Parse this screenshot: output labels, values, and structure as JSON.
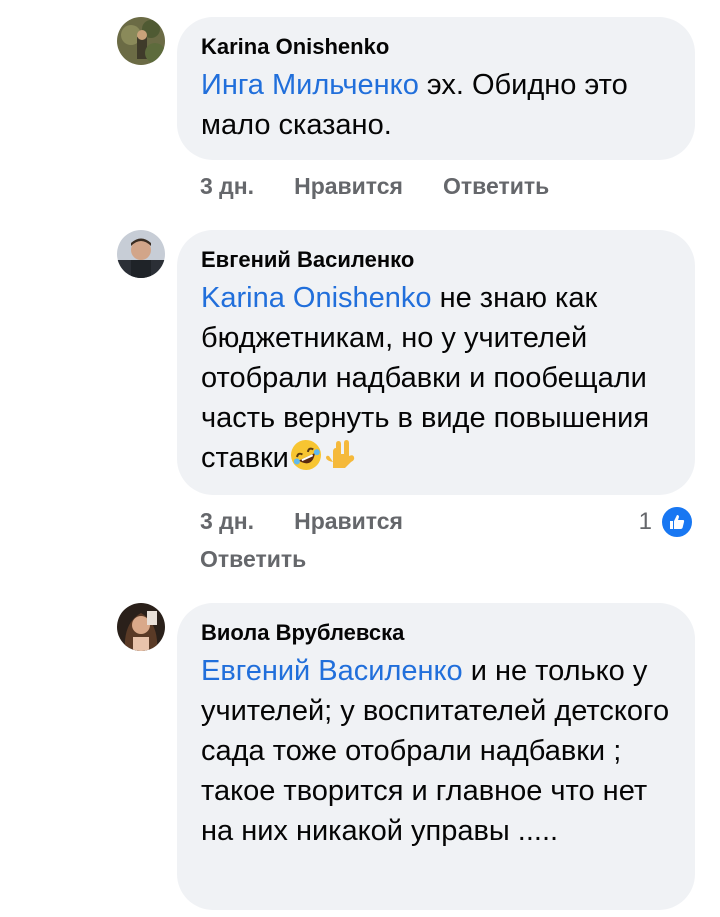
{
  "comments": [
    {
      "author": "Karina Onishenko",
      "mention": "Инга Мильченко",
      "text": " эх. Обидно это мало сказано.",
      "time": "3 дн.",
      "like_label": "Нравится",
      "reply_label": "Ответить"
    },
    {
      "author": "Евгений Василенко",
      "mention": "Karina Onishenko",
      "text": " не знаю как бюджетникам, но у учителей отобрали надбавки и пообещали часть вернуть в виде повышения ставки",
      "emojis": [
        "rofl-emoji",
        "love-you-gesture-emoji"
      ],
      "time": "3 дн.",
      "like_label": "Нравится",
      "reply_label": "Ответить",
      "reaction_count": "1",
      "reaction_icon": "thumbs-up-icon"
    },
    {
      "author": "Виола Врублевска",
      "mention": "Евгений Василенко",
      "text": " и не только у учителей; у воспитателей детского сада тоже отобрали надбавки ; такое творится и главное что нет на них никакой управы .....",
      "time": "",
      "like_label": "",
      "reply_label": ""
    }
  ],
  "colors": {
    "mention": "#216fdb",
    "bubble": "#f0f2f5",
    "meta": "#65676b",
    "like": "#1877f2"
  }
}
